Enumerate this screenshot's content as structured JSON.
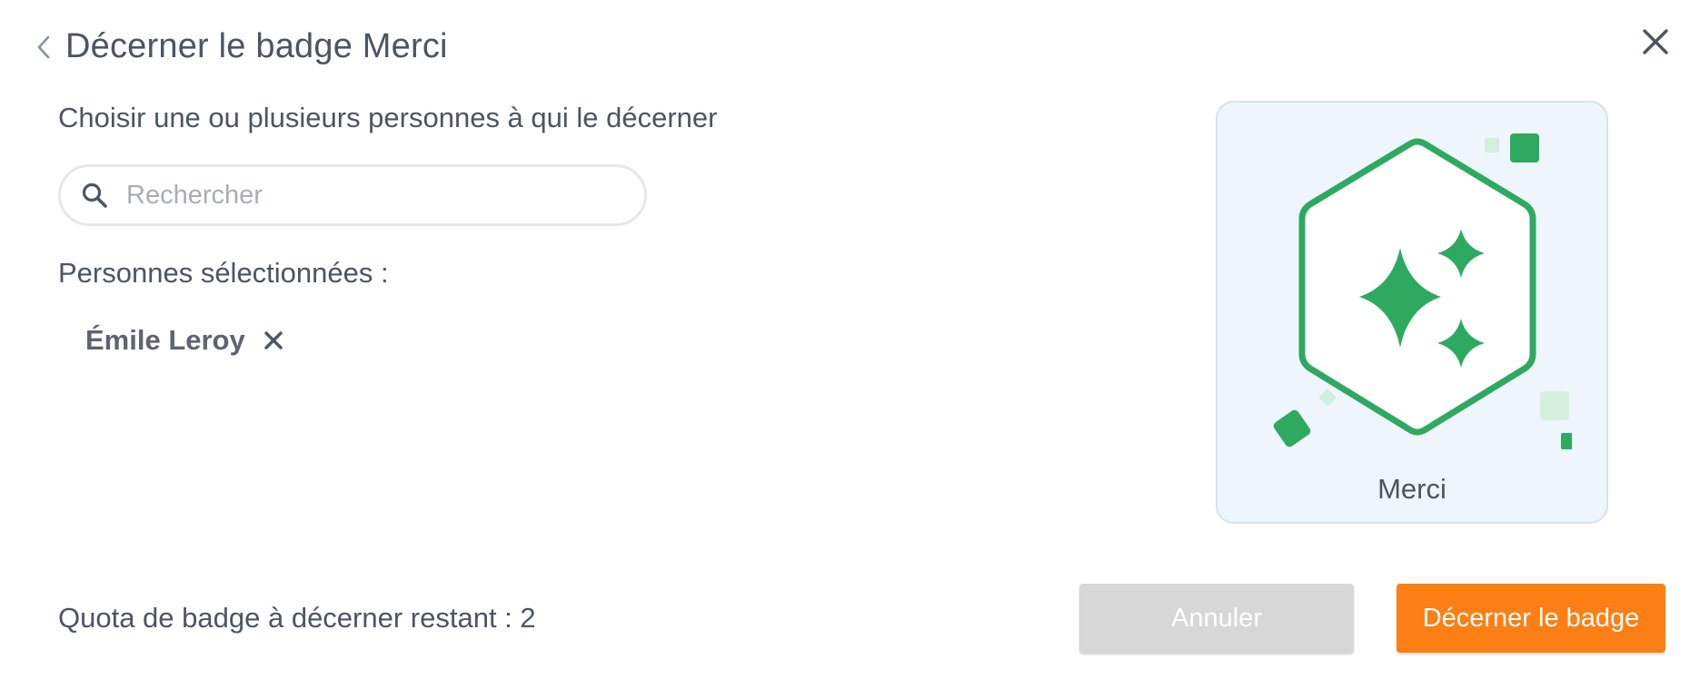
{
  "header": {
    "title": "Décerner le badge Merci",
    "back_icon": "chevron-left-icon"
  },
  "close_icon": "close-icon",
  "instruction": "Choisir une ou plusieurs personnes à qui le décerner",
  "search": {
    "placeholder": "Rechercher",
    "value": "",
    "icon": "search-icon"
  },
  "selected": {
    "label": "Personnes sélectionnées :",
    "people": [
      {
        "name": "Émile Leroy",
        "remove_icon": "remove-x-icon"
      }
    ]
  },
  "badge": {
    "name": "Merci",
    "icon": "sparkles-hexagon-badge-icon",
    "accent": "#2daa5f",
    "card_bg": "#eef6fb"
  },
  "quota": {
    "text": "Quota de badge à décerner restant : 2"
  },
  "actions": {
    "cancel_label": "Annuler",
    "award_label": "Décerner le badge",
    "award_color": "#fb7f14",
    "cancel_color": "#d7d7d7"
  }
}
